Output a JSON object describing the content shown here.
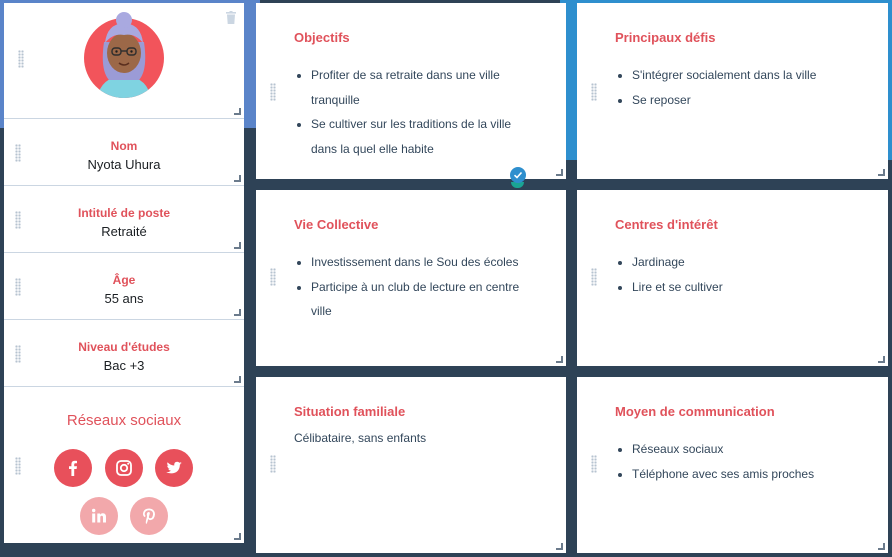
{
  "profile": {
    "fields": [
      {
        "label": "Nom",
        "value": "Nyota Uhura"
      },
      {
        "label": "Intitulé de poste",
        "value": "Retraité"
      },
      {
        "label": "Âge",
        "value": "55 ans"
      },
      {
        "label": "Niveau d'études",
        "value": "Bac +3"
      }
    ],
    "social": {
      "title": "Réseaux sociaux",
      "icons": [
        "facebook-icon",
        "instagram-icon",
        "twitter-icon",
        "linkedin-icon",
        "pinterest-icon"
      ]
    }
  },
  "cards": {
    "objectifs": {
      "title": "Objectifs",
      "items": [
        "Profiter de sa retraite dans une ville tranquille",
        "Se cultiver sur les traditions de  la ville dans la quel elle habite"
      ]
    },
    "defis": {
      "title": "Principaux défis",
      "items": [
        "S'intégrer socialement dans la ville",
        "Se reposer"
      ]
    },
    "vie_collective": {
      "title": "Vie Collective",
      "items": [
        "Investissement dans le Sou des écoles",
        "Participe à un club de lecture en centre ville"
      ]
    },
    "centres": {
      "title": "Centres d'intérêt",
      "items": [
        "Jardinage",
        "Lire et se cultiver"
      ]
    },
    "situation": {
      "title": "Situation familiale",
      "text": "Célibataire, sans enfants"
    },
    "communication": {
      "title": "Moyen de communication",
      "items": [
        "Réseaux sociaux",
        "Téléphone avec ses amis proches"
      ]
    }
  },
  "colors": {
    "accent": "#e0525b",
    "icon_bg": "#e8505b",
    "icon_faded": "#f2a8ab",
    "background": "#2e4256",
    "header_blue": "#2e8fce"
  }
}
